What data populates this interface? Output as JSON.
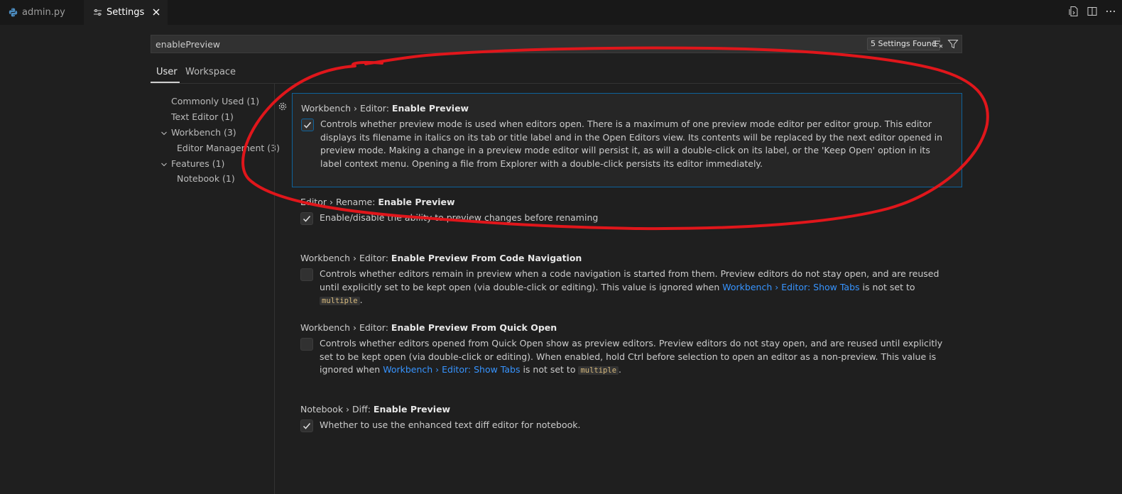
{
  "tabs": {
    "file_tab": "admin.py",
    "settings_tab": "Settings"
  },
  "search": {
    "value": "enablePreview",
    "found_badge": "5 Settings Found"
  },
  "scope": {
    "user": "User",
    "workspace": "Workspace"
  },
  "toc": {
    "commonly_used": "Commonly Used (1)",
    "text_editor": "Text Editor (1)",
    "workbench": "Workbench (3)",
    "editor_management": "Editor Management (3)",
    "features": "Features (1)",
    "notebook": "Notebook (1)"
  },
  "settings": [
    {
      "category": "Workbench › Editor: ",
      "name": "Enable Preview",
      "checked": true,
      "description": "Controls whether preview mode is used when editors open. There is a maximum of one preview mode editor per editor group. This editor displays its filename in italics on its tab or title label and in the Open Editors view. Its contents will be replaced by the next editor opened in preview mode. Making a change in a preview mode editor will persist it, as will a double-click on its label, or the 'Keep Open' option in its label context menu. Opening a file from Explorer with a double-click persists its editor immediately."
    },
    {
      "category": "Editor › Rename: ",
      "name": "Enable Preview",
      "checked": true,
      "description": "Enable/disable the ability to preview changes before renaming"
    },
    {
      "category": "Workbench › Editor: ",
      "name": "Enable Preview From Code Navigation",
      "checked": false,
      "description_before": "Controls whether editors remain in preview when a code navigation is started from them. Preview editors do not stay open, and are reused until explicitly set to be kept open (via double-click or editing). This value is ignored when ",
      "link": "Workbench › Editor: Show Tabs",
      "description_middle": " is not set to ",
      "code": "multiple",
      "description_after": "."
    },
    {
      "category": "Workbench › Editor: ",
      "name": "Enable Preview From Quick Open",
      "checked": false,
      "description_before": "Controls whether editors opened from Quick Open show as preview editors. Preview editors do not stay open, and are reused until explicitly set to be kept open (via double-click or editing). When enabled, hold Ctrl before selection to open an editor as a non-preview. This value is ignored when ",
      "link": "Workbench › Editor: Show Tabs",
      "description_middle": " is not set to ",
      "code": "multiple",
      "description_after": "."
    },
    {
      "category": "Notebook › Diff: ",
      "name": "Enable Preview",
      "checked": true,
      "description": "Whether to use the enhanced text diff editor for notebook."
    }
  ],
  "colors": {
    "background": "#1f1f1f",
    "tabbar": "#181818",
    "focus_border": "#0e639c",
    "link": "#3794ff",
    "annotation": "#e0161b"
  }
}
